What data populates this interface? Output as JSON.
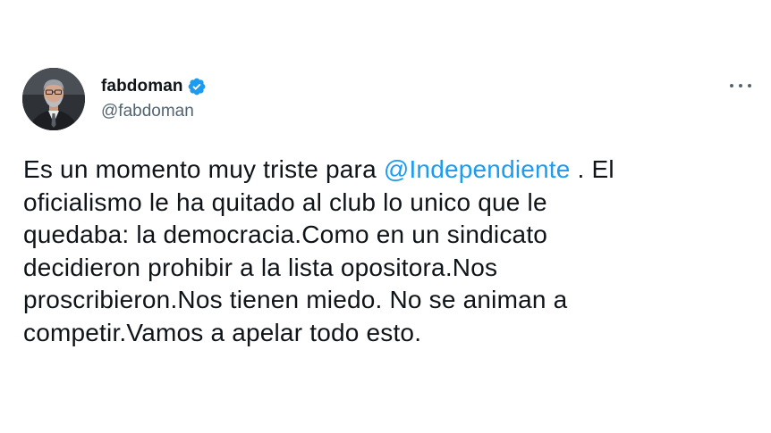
{
  "author": {
    "display_name": "fabdoman",
    "handle": "@fabdoman",
    "verified": true,
    "verified_color": "#1d9bf0"
  },
  "icons": {
    "more": "more-horizontal-icon",
    "verified": "verified-badge-icon"
  },
  "tweet": {
    "line1_before": "Es un momento muy triste para ",
    "mention": "@Independiente",
    "line1_after": " . El",
    "line2": "oficialismo le ha quitado al club lo unico que le",
    "line3": "quedaba: la democracia.Como en un sindicato",
    "line4": "decidieron prohibir a la lista opositora.Nos",
    "line5": "proscribieron.Nos tienen miedo. No se animan a",
    "line6": "competir.Vamos a apelar todo esto."
  },
  "colors": {
    "text": "#0f1419",
    "secondary": "#536471",
    "link": "#1d9bf0"
  }
}
